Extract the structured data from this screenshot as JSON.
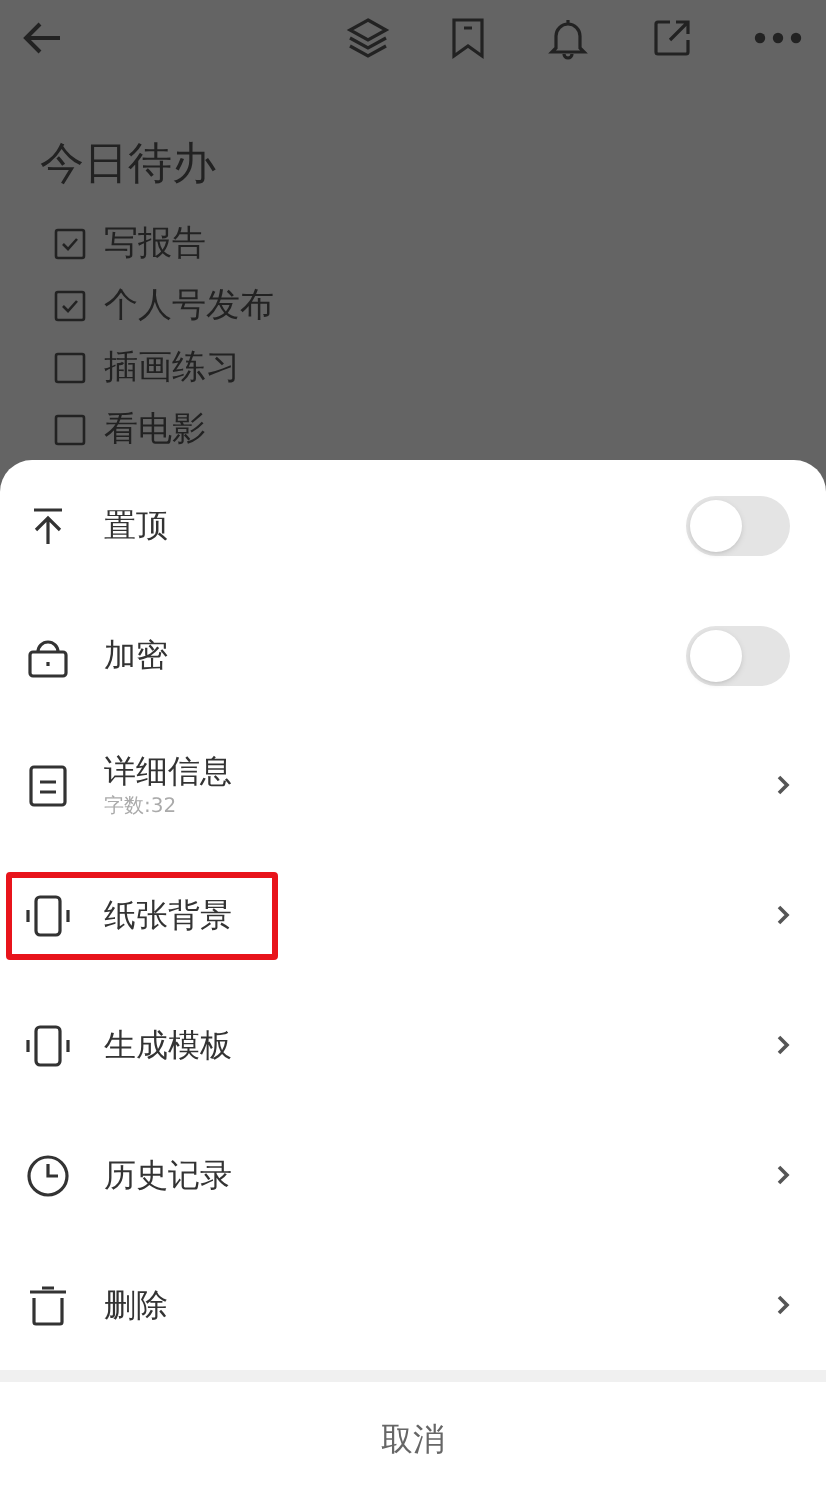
{
  "note": {
    "title": "今日待办",
    "todos": [
      {
        "text": "写报告",
        "checked": true
      },
      {
        "text": "个人号发布",
        "checked": true
      },
      {
        "text": "插画练习",
        "checked": false
      },
      {
        "text": "看电影",
        "checked": false
      }
    ]
  },
  "menu": {
    "items": [
      {
        "kind": "toggle",
        "label": "置顶",
        "on": false,
        "highlighted": false
      },
      {
        "kind": "toggle",
        "label": "加密",
        "on": false,
        "highlighted": false
      },
      {
        "kind": "link",
        "label": "详细信息",
        "subtitle": "字数:32",
        "highlighted": false
      },
      {
        "kind": "link",
        "label": "纸张背景",
        "highlighted": true
      },
      {
        "kind": "link",
        "label": "生成模板",
        "highlighted": false
      },
      {
        "kind": "link",
        "label": "历史记录",
        "highlighted": false
      },
      {
        "kind": "link",
        "label": "删除",
        "highlighted": false
      }
    ],
    "cancel": "取消"
  }
}
